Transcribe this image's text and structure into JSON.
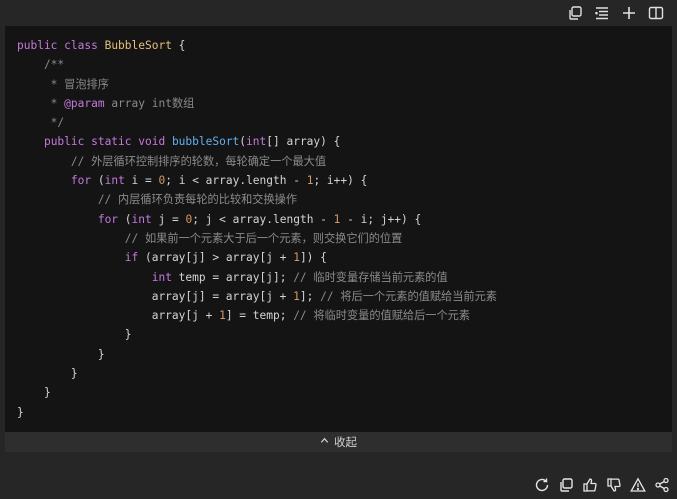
{
  "toolbar": {
    "icons": [
      "copy-icon",
      "format-list-icon",
      "plus-icon",
      "split-view-icon"
    ]
  },
  "code": {
    "lines": [
      [
        {
          "t": "kw",
          "v": "public "
        },
        {
          "t": "kw",
          "v": "class "
        },
        {
          "t": "cls",
          "v": "BubbleSort"
        },
        {
          "t": "p",
          "v": " {"
        }
      ],
      [
        {
          "t": "cm",
          "v": "    /**"
        }
      ],
      [
        {
          "t": "cm",
          "v": "     * "
        },
        {
          "t": "cmc",
          "v": "冒泡排序"
        }
      ],
      [
        {
          "t": "cm",
          "v": "     * "
        },
        {
          "t": "ann",
          "v": "@param"
        },
        {
          "t": "cm",
          "v": " array int"
        },
        {
          "t": "cmc",
          "v": "数组"
        }
      ],
      [
        {
          "t": "cm",
          "v": "     */"
        }
      ],
      [
        {
          "t": "p",
          "v": "    "
        },
        {
          "t": "kw",
          "v": "public static void "
        },
        {
          "t": "fn",
          "v": "bubbleSort"
        },
        {
          "t": "p",
          "v": "("
        },
        {
          "t": "kw",
          "v": "int"
        },
        {
          "t": "p",
          "v": "[] array) {"
        }
      ],
      [
        {
          "t": "cm",
          "v": "        // "
        },
        {
          "t": "cmc",
          "v": "外层循环控制排序的轮数，每轮确定一个最大值"
        }
      ],
      [
        {
          "t": "p",
          "v": "        "
        },
        {
          "t": "kw",
          "v": "for"
        },
        {
          "t": "p",
          "v": " ("
        },
        {
          "t": "kw",
          "v": "int"
        },
        {
          "t": "p",
          "v": " i = "
        },
        {
          "t": "num",
          "v": "0"
        },
        {
          "t": "p",
          "v": "; i < array.length - "
        },
        {
          "t": "num",
          "v": "1"
        },
        {
          "t": "p",
          "v": "; i++) {"
        }
      ],
      [
        {
          "t": "cm",
          "v": "            // "
        },
        {
          "t": "cmc",
          "v": "内层循环负责每轮的比较和交换操作"
        }
      ],
      [
        {
          "t": "p",
          "v": "            "
        },
        {
          "t": "kw",
          "v": "for"
        },
        {
          "t": "p",
          "v": " ("
        },
        {
          "t": "kw",
          "v": "int"
        },
        {
          "t": "p",
          "v": " j = "
        },
        {
          "t": "num",
          "v": "0"
        },
        {
          "t": "p",
          "v": "; j < array.length - "
        },
        {
          "t": "num",
          "v": "1"
        },
        {
          "t": "p",
          "v": " - i; j++) {"
        }
      ],
      [
        {
          "t": "cm",
          "v": "                // "
        },
        {
          "t": "cmc",
          "v": "如果前一个元素大于后一个元素，则交换它们的位置"
        }
      ],
      [
        {
          "t": "p",
          "v": "                "
        },
        {
          "t": "kw",
          "v": "if"
        },
        {
          "t": "p",
          "v": " (array[j] > array[j + "
        },
        {
          "t": "num",
          "v": "1"
        },
        {
          "t": "p",
          "v": "]) {"
        }
      ],
      [
        {
          "t": "p",
          "v": "                    "
        },
        {
          "t": "kw",
          "v": "int"
        },
        {
          "t": "p",
          "v": " temp = array[j]; "
        },
        {
          "t": "cm",
          "v": "// "
        },
        {
          "t": "cmc",
          "v": "临时变量存储当前元素的值"
        }
      ],
      [
        {
          "t": "p",
          "v": "                    array[j] = array[j + "
        },
        {
          "t": "num",
          "v": "1"
        },
        {
          "t": "p",
          "v": "]; "
        },
        {
          "t": "cm",
          "v": "// "
        },
        {
          "t": "cmc",
          "v": "将后一个元素的值赋给当前元素"
        }
      ],
      [
        {
          "t": "p",
          "v": "                    array[j + "
        },
        {
          "t": "num",
          "v": "1"
        },
        {
          "t": "p",
          "v": "] = temp; "
        },
        {
          "t": "cm",
          "v": "// "
        },
        {
          "t": "cmc",
          "v": "将临时变量的值赋给后一个元素"
        }
      ],
      [
        {
          "t": "p",
          "v": "                }"
        }
      ],
      [
        {
          "t": "p",
          "v": "            }"
        }
      ],
      [
        {
          "t": "p",
          "v": "        }"
        }
      ],
      [
        {
          "t": "p",
          "v": "    }"
        }
      ],
      [
        {
          "t": "p",
          "v": "}"
        }
      ]
    ]
  },
  "collapse": {
    "label": "收起",
    "chevron": "^"
  },
  "bottom_actions": {
    "icons": [
      "refresh-icon",
      "copy-icon",
      "thumbs-up-icon",
      "thumbs-down-icon",
      "warning-icon",
      "share-icon"
    ]
  },
  "colors": {
    "background": "#262626",
    "code_background": "#141414",
    "keyword": "#c678dd",
    "class_name": "#e5c07b",
    "function": "#61afef",
    "number": "#d19a66",
    "comment": "#8b8b8b"
  }
}
